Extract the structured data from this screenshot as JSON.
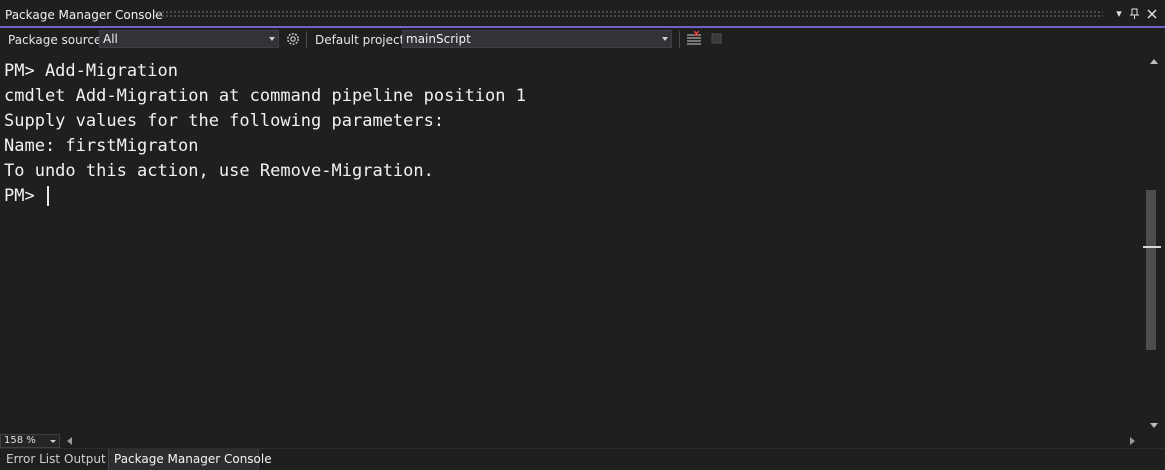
{
  "window": {
    "title": "Package Manager Console",
    "accent_color": "#6e64c8",
    "buttons": [
      {
        "icon": "dropdown-icon",
        "glyph": "▾"
      },
      {
        "icon": "pin-icon",
        "glyph": "⊥"
      },
      {
        "icon": "close-icon",
        "glyph": "✕"
      }
    ]
  },
  "toolbar": {
    "package_source_label": "Package source:",
    "package_source_value": "All",
    "default_project_label": "Default project:",
    "default_project_value": "mainScript",
    "settings_icon": "gear-icon",
    "clear_icon": "clear-console-icon",
    "stop_icon": "stop-icon"
  },
  "console": {
    "lines": [
      "PM> Add-Migration",
      "cmdlet Add-Migration at command pipeline position 1",
      "Supply values for the following parameters:",
      "Name: firstMigraton",
      "To undo this action, use Remove-Migration.",
      "PM> "
    ]
  },
  "zoom": {
    "value": "158 %"
  },
  "tabs": [
    {
      "label": "Error List",
      "active": false
    },
    {
      "label": "Output",
      "active": false
    },
    {
      "label": "Package Manager Console",
      "active": true
    }
  ]
}
